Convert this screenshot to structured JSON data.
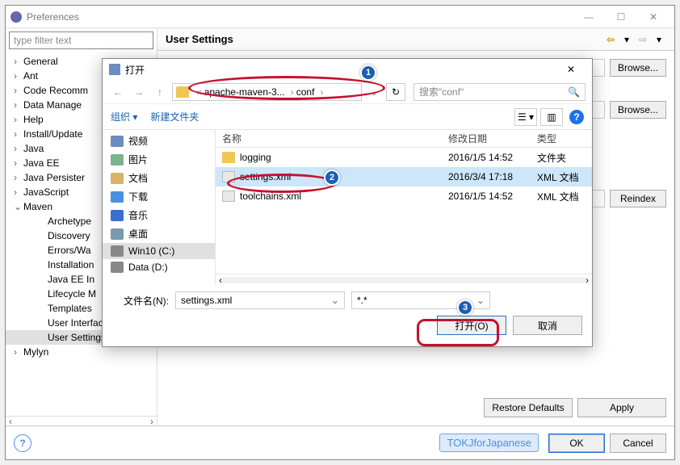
{
  "pref": {
    "title": "Preferences",
    "filter_placeholder": "type filter text",
    "header": "User Settings",
    "tree": [
      {
        "label": "General",
        "chev": "›"
      },
      {
        "label": "Ant",
        "chev": "›"
      },
      {
        "label": "Code Recomm",
        "chev": "›"
      },
      {
        "label": "Data Manage",
        "chev": "›"
      },
      {
        "label": "Help",
        "chev": "›"
      },
      {
        "label": "Install/Update",
        "chev": "›"
      },
      {
        "label": "Java",
        "chev": "›"
      },
      {
        "label": "Java EE",
        "chev": "›"
      },
      {
        "label": "Java Persister",
        "chev": "›"
      },
      {
        "label": "JavaScript",
        "chev": "›"
      },
      {
        "label": "Maven",
        "chev": "⌄",
        "expanded": true
      },
      {
        "label": "Archetype",
        "level": 2
      },
      {
        "label": "Discovery",
        "level": 2
      },
      {
        "label": "Errors/Wa",
        "level": 2
      },
      {
        "label": "Installation",
        "level": 2
      },
      {
        "label": "Java EE In",
        "level": 2
      },
      {
        "label": "Lifecycle M",
        "level": 2
      },
      {
        "label": "Templates",
        "level": 2
      },
      {
        "label": "User Interface",
        "level": 2
      },
      {
        "label": "User Settings",
        "level": 2,
        "selected": true
      },
      {
        "label": "Mylyn",
        "chev": "›"
      }
    ],
    "browse": "Browse...",
    "reindex": "Reindex",
    "restore": "Restore Defaults",
    "apply": "Apply",
    "ok": "OK",
    "cancel": "Cancel",
    "watermark": "TOKJforJapanese"
  },
  "fd": {
    "title": "打开",
    "path_seg1": "apache-maven-3...",
    "path_seg2": "conf",
    "search_placeholder": "搜索\"conf\"",
    "organize": "组织",
    "newfolder": "新建文件夹",
    "side": [
      {
        "label": "视频",
        "ico": "video"
      },
      {
        "label": "图片",
        "ico": "image"
      },
      {
        "label": "文档",
        "ico": "doc"
      },
      {
        "label": "下载",
        "ico": "dl"
      },
      {
        "label": "音乐",
        "ico": "music"
      },
      {
        "label": "桌面",
        "ico": "desk"
      },
      {
        "label": "Win10 (C:)",
        "ico": "drive",
        "selected": true
      },
      {
        "label": "Data (D:)",
        "ico": "drive"
      }
    ],
    "cols": {
      "name": "名称",
      "date": "修改日期",
      "type": "类型"
    },
    "rows": [
      {
        "name": "logging",
        "date": "2016/1/5 14:52",
        "type": "文件夹",
        "ico": "folder"
      },
      {
        "name": "settings.xml",
        "date": "2016/3/4 17:18",
        "type": "XML 文档",
        "ico": "file",
        "selected": true
      },
      {
        "name": "toolchains.xml",
        "date": "2016/1/5 14:52",
        "type": "XML 文档",
        "ico": "file"
      }
    ],
    "filename_label": "文件名(N):",
    "filename_value": "settings.xml",
    "filetype_value": "*.*",
    "open_btn": "打开(O)",
    "cancel_btn": "取消"
  },
  "annot": {
    "b1": "1",
    "b2": "2",
    "b3": "3"
  }
}
